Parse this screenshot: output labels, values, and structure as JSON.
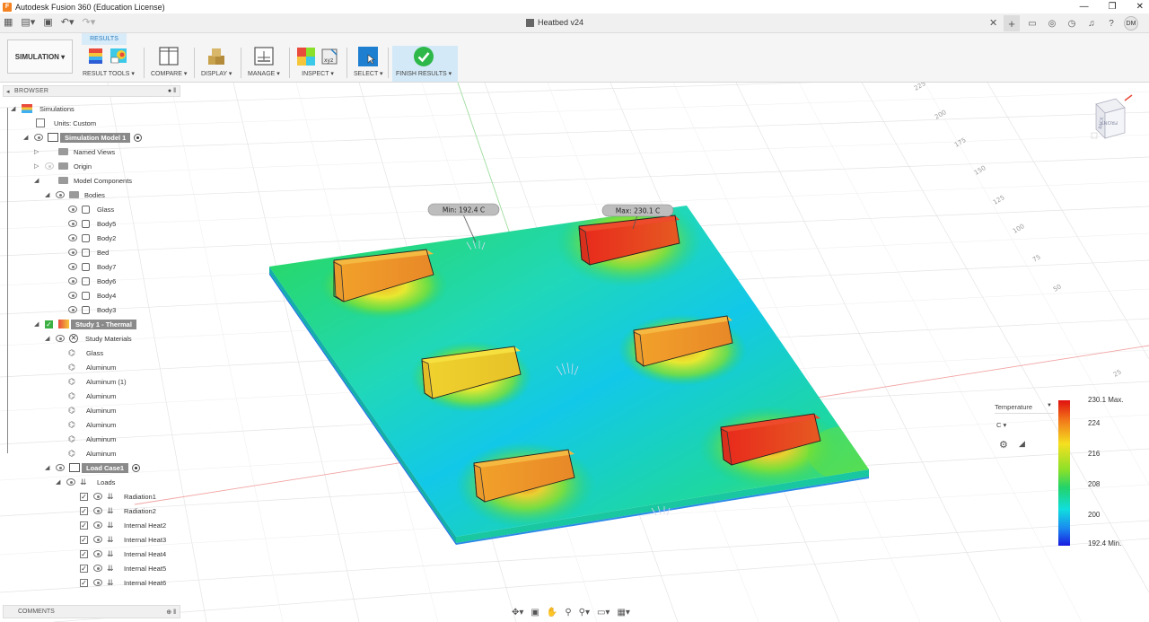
{
  "app": {
    "title": "Autodesk Fusion 360 (Education License)",
    "icon_letter": "F"
  },
  "window_controls": {
    "minimize": "—",
    "maximize": "❐",
    "close": "✕"
  },
  "document": {
    "tab_title": "Heatbed v24",
    "close": "✕"
  },
  "user": {
    "initials": "DM"
  },
  "ribbon": {
    "workspace": "SIMULATION ▾",
    "active_tab": "RESULTS",
    "groups": {
      "result_tools": "RESULT TOOLS ▾",
      "compare": "COMPARE ▾",
      "display": "DISPLAY ▾",
      "manage": "MANAGE ▾",
      "inspect": "INSPECT ▾",
      "select": "SELECT ▾",
      "finish": "FINISH RESULTS ▾"
    }
  },
  "browser": {
    "header": "BROWSER",
    "items": {
      "simulations": "Simulations",
      "units": "Units: Custom",
      "sim_model": "Simulation Model 1",
      "named_views": "Named Views",
      "origin": "Origin",
      "model_components": "Model Components",
      "bodies": "Bodies",
      "glass": "Glass",
      "body5": "Body5",
      "body2": "Body2",
      "bed": "Bed",
      "body7": "Body7",
      "body6": "Body6",
      "body4": "Body4",
      "body3": "Body3",
      "study": "Study 1 - Thermal",
      "study_materials": "Study Materials",
      "mat_glass": "Glass",
      "mat_al1": "Aluminum",
      "mat_al2": "Aluminum (1)",
      "mat_al3": "Aluminum",
      "mat_al4": "Aluminum",
      "mat_al5": "Aluminum",
      "mat_al6": "Aluminum",
      "mat_al7": "Aluminum",
      "load_case": "Load Case1",
      "loads": "Loads",
      "rad1": "Radiation1",
      "rad2": "Radiation2",
      "ih2": "Internal Heat2",
      "ih3": "Internal Heat3",
      "ih4": "Internal Heat4",
      "ih5": "Internal Heat5",
      "ih6": "Internal Heat6"
    }
  },
  "comments": {
    "header": "COMMENTS"
  },
  "probes": {
    "min": "Min: 192.4 C",
    "max": "Max: 230.1 C"
  },
  "legend": {
    "quantity": "Temperature",
    "unit": "C ▾",
    "max_label": "230.1 Max.",
    "min_label": "192.4 Min.",
    "ticks": [
      "224",
      "216",
      "208",
      "200"
    ],
    "max": 230.1,
    "min": 192.4
  },
  "grid_labels": [
    "225",
    "200",
    "175",
    "150",
    "125",
    "100",
    "75",
    "50",
    "25"
  ],
  "viewcube": {
    "front": "FRONT",
    "back": "BACK",
    "right": "RIGHT"
  }
}
